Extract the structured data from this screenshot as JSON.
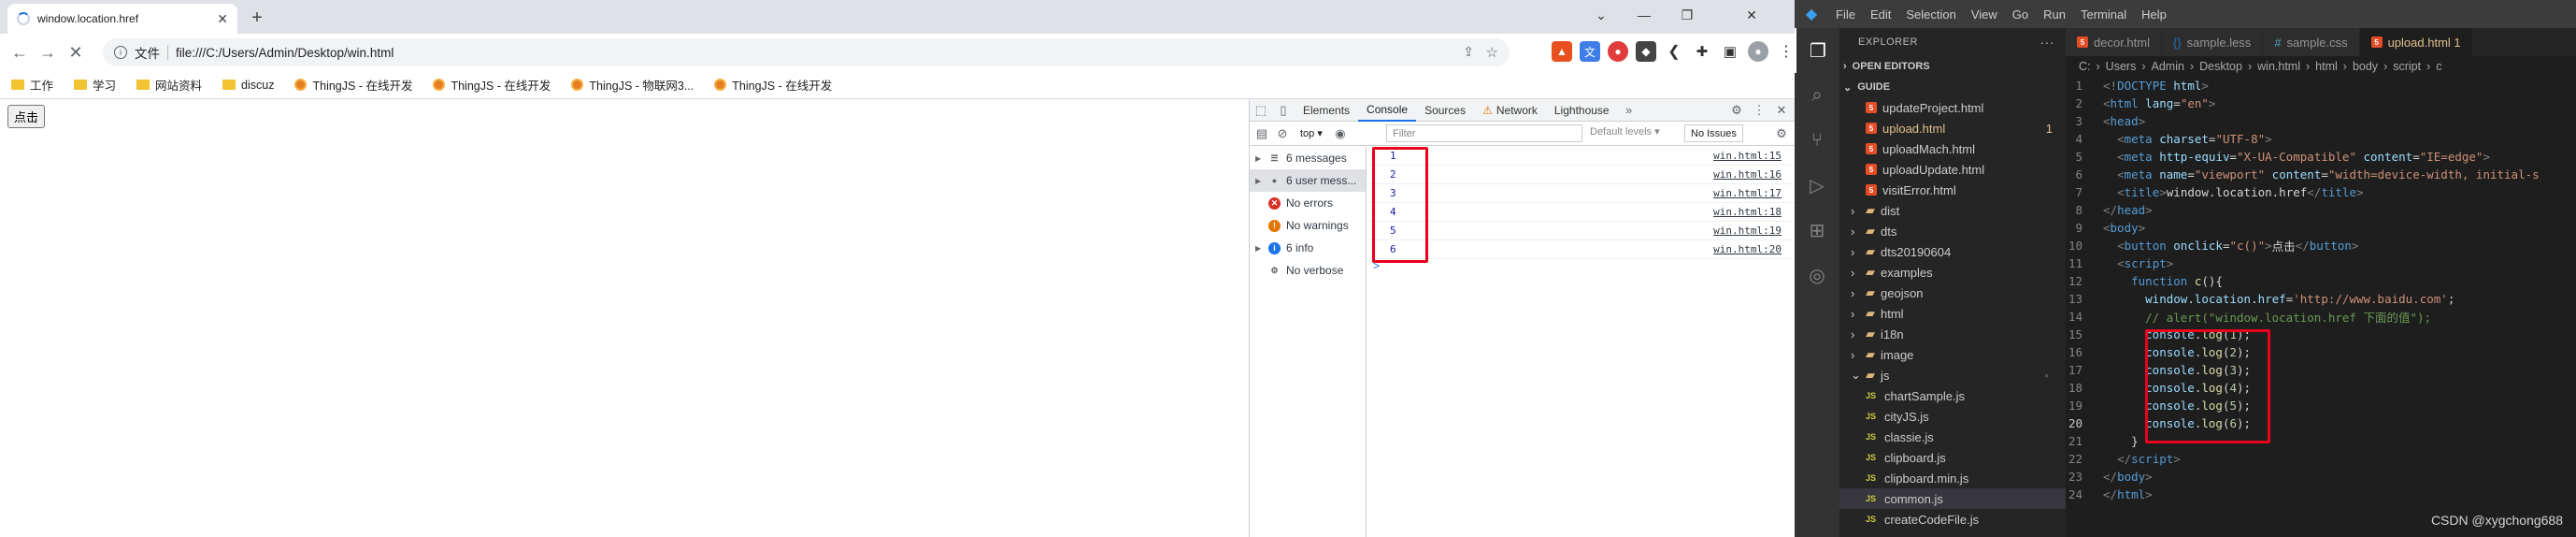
{
  "browser": {
    "tab_title": "window.location.href",
    "address_scheme": "文件",
    "address_url": "file:///C:/Users/Admin/Desktop/win.html",
    "bookmarks": [
      {
        "label": "工作",
        "icon": "folder-icon"
      },
      {
        "label": "学习",
        "icon": "folder-icon"
      },
      {
        "label": "网站资料",
        "icon": "folder-icon"
      },
      {
        "label": "discuz",
        "icon": "folder-icon"
      },
      {
        "label": "ThingJS - 在线开发",
        "icon": "thingjs-icon"
      },
      {
        "label": "ThingJS - 在线开发",
        "icon": "thingjs-icon"
      },
      {
        "label": "ThingJS - 物联网3...",
        "icon": "thingjs-icon"
      },
      {
        "label": "ThingJS - 在线开发",
        "icon": "thingjs-icon"
      }
    ],
    "page_button_label": "点击"
  },
  "devtools": {
    "tabs": [
      "Elements",
      "Console",
      "Sources",
      "Network",
      "Lighthouse"
    ],
    "active_tab": "Console",
    "context": "top",
    "filter_placeholder": "Filter",
    "levels_label": "Default levels",
    "issues_label": "No Issues",
    "sidebar": [
      {
        "label": "6 messages",
        "icon": "list-icon",
        "expandable": true
      },
      {
        "label": "6 user mess...",
        "icon": "user-icon",
        "expandable": true
      },
      {
        "label": "No errors",
        "icon": "error-icon",
        "expandable": false
      },
      {
        "label": "No warnings",
        "icon": "warning-icon",
        "expandable": false
      },
      {
        "label": "6 info",
        "icon": "info-icon",
        "expandable": true
      },
      {
        "label": "No verbose",
        "icon": "verbose-icon",
        "expandable": false
      }
    ],
    "logs": [
      {
        "value": "1",
        "source": "win.html:15"
      },
      {
        "value": "2",
        "source": "win.html:16"
      },
      {
        "value": "3",
        "source": "win.html:17"
      },
      {
        "value": "4",
        "source": "win.html:18"
      },
      {
        "value": "5",
        "source": "win.html:19"
      },
      {
        "value": "6",
        "source": "win.html:20"
      }
    ],
    "prompt": ">"
  },
  "vscode": {
    "menu": [
      "File",
      "Edit",
      "Selection",
      "View",
      "Go",
      "Run",
      "Terminal",
      "Help"
    ],
    "explorer_title": "EXPLORER",
    "open_editors": "OPEN EDITORS",
    "workspace": "GUIDE",
    "tree": [
      {
        "label": "updateProject.html",
        "type": "html",
        "indent": 2
      },
      {
        "label": "upload.html",
        "type": "html",
        "indent": 2,
        "badge": "1",
        "modified": true
      },
      {
        "label": "uploadMach.html",
        "type": "html",
        "indent": 2
      },
      {
        "label": "uploadUpdate.html",
        "type": "html",
        "indent": 2
      },
      {
        "label": "visitError.html",
        "type": "html",
        "indent": 2
      },
      {
        "label": "dist",
        "type": "dir",
        "indent": 1
      },
      {
        "label": "dts",
        "type": "dir",
        "indent": 1
      },
      {
        "label": "dts20190604",
        "type": "dir",
        "indent": 1
      },
      {
        "label": "examples",
        "type": "dir",
        "indent": 1
      },
      {
        "label": "geojson",
        "type": "dir",
        "indent": 1
      },
      {
        "label": "html",
        "type": "dir",
        "indent": 1
      },
      {
        "label": "i18n",
        "type": "dir",
        "indent": 1
      },
      {
        "label": "image",
        "type": "dir",
        "indent": 1
      },
      {
        "label": "js",
        "type": "diropen",
        "indent": 1
      },
      {
        "label": "chartSample.js",
        "type": "js",
        "indent": 2
      },
      {
        "label": "cityJS.js",
        "type": "js",
        "indent": 2
      },
      {
        "label": "classie.js",
        "type": "js",
        "indent": 2
      },
      {
        "label": "clipboard.js",
        "type": "js",
        "indent": 2
      },
      {
        "label": "clipboard.min.js",
        "type": "js",
        "indent": 2
      },
      {
        "label": "common.js",
        "type": "js",
        "indent": 2,
        "selected": true
      },
      {
        "label": "createCodeFile.js",
        "type": "js",
        "indent": 2
      }
    ],
    "editor_tabs": [
      {
        "label": "decor.html",
        "type": "html"
      },
      {
        "label": "sample.less",
        "type": "less"
      },
      {
        "label": "sample.css",
        "type": "css"
      },
      {
        "label": "upload.html 1",
        "type": "html",
        "active": true
      }
    ],
    "breadcrumbs": [
      "C:",
      "Users",
      "Admin",
      "Desktop",
      "win.html",
      "html",
      "body",
      "script",
      "c"
    ],
    "current_line": 20,
    "watermark": "CSDN @xygchong688"
  }
}
